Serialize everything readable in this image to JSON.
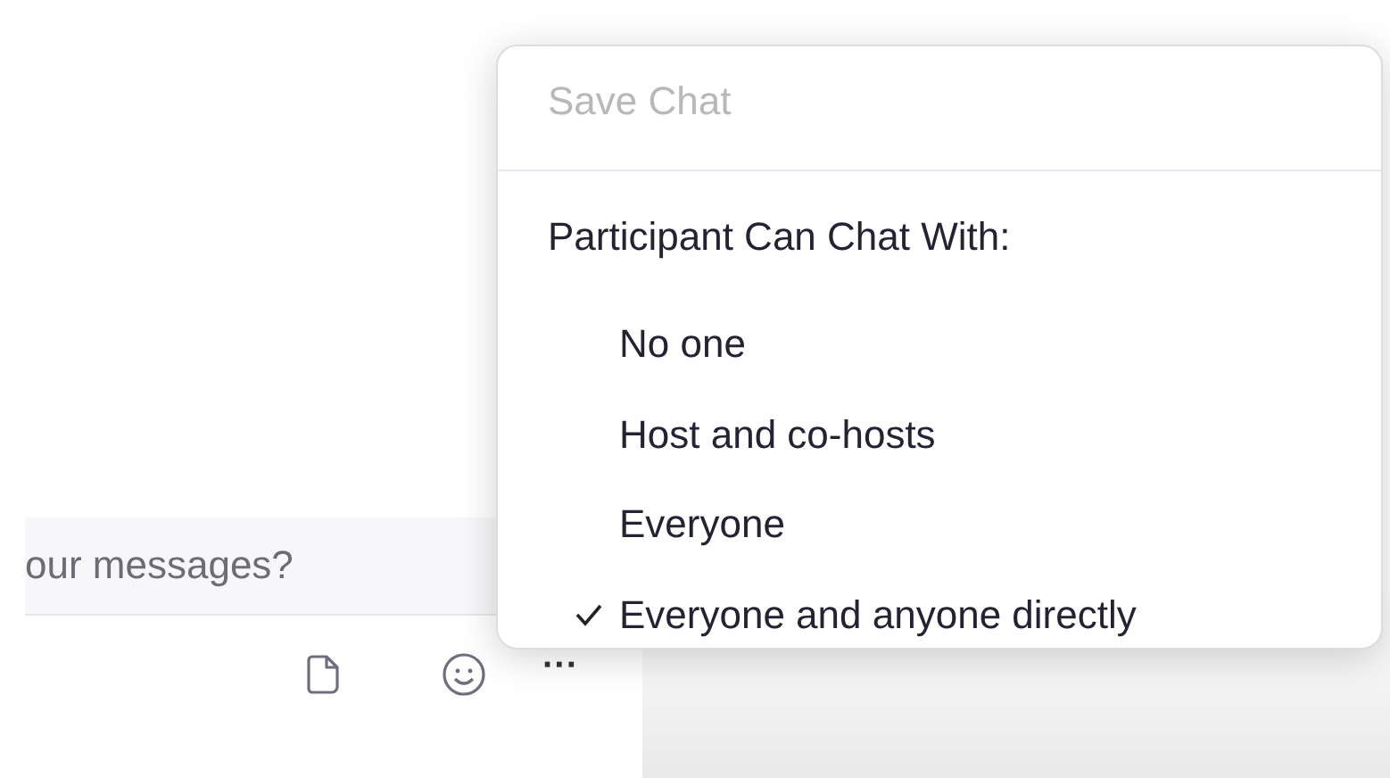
{
  "chat_input": {
    "placeholder": "our messages?"
  },
  "toolbar": [
    {
      "kind": "file"
    },
    {
      "kind": "emoji"
    },
    {
      "kind": "more",
      "label": "···"
    }
  ],
  "menu": {
    "save": {
      "label": "Save Chat",
      "disabled": true
    },
    "header": "Participant Can Chat With:",
    "options": [
      {
        "label": "No one",
        "selected": false
      },
      {
        "label": "Host and co-hosts",
        "selected": false
      },
      {
        "label": "Everyone",
        "selected": false
      },
      {
        "label": "Everyone and anyone directly",
        "selected": true
      }
    ]
  }
}
